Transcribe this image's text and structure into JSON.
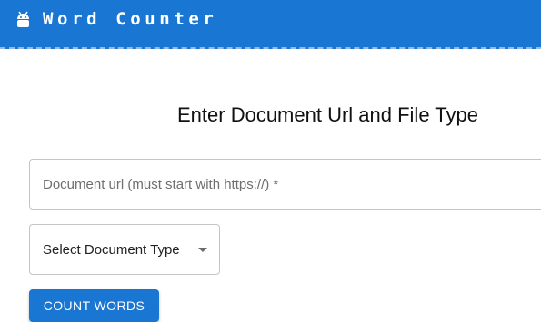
{
  "appbar": {
    "title": "Word Counter",
    "icon": "android-icon",
    "color": "#1976d2"
  },
  "main": {
    "heading": "Enter Document Url and File Type",
    "url_input": {
      "placeholder": "Document url (must start with https://) *",
      "value": ""
    },
    "type_select": {
      "selected": "Select Document Type"
    },
    "count_button": {
      "label": "COUNT WORDS"
    }
  }
}
